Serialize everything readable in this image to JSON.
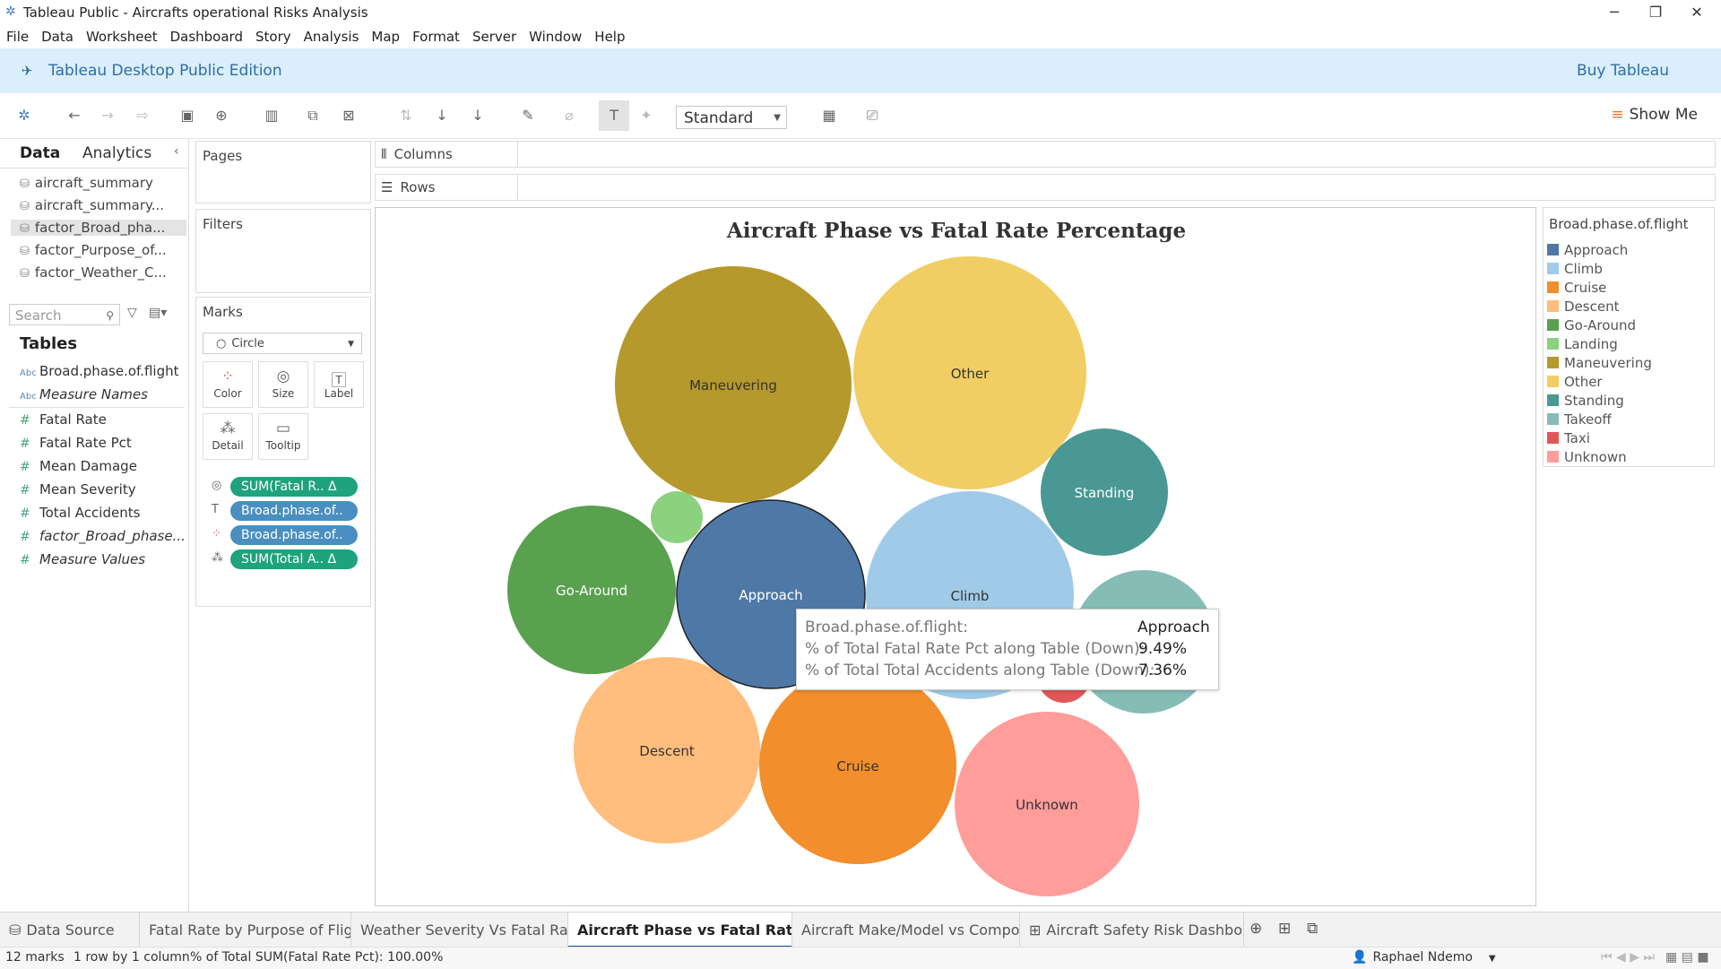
{
  "window": {
    "title": "Tableau Public - Aircrafts operational Risks Analysis"
  },
  "menu": [
    "File",
    "Data",
    "Worksheet",
    "Dashboard",
    "Story",
    "Analysis",
    "Map",
    "Format",
    "Server",
    "Window",
    "Help"
  ],
  "banner": {
    "edition": "Tableau Desktop Public Edition",
    "buy": "Buy Tableau"
  },
  "toolbar": {
    "fit_mode": "Standard",
    "show_me": "Show Me"
  },
  "data_pane": {
    "tab_data": "Data",
    "tab_analytics": "Analytics",
    "sources": [
      "aircraft_summary",
      "aircraft_summary...",
      "factor_Broad_pha...",
      "factor_Purpose_of...",
      "factor_Weather_C..."
    ],
    "search_placeholder": "Search",
    "tables_heading": "Tables",
    "fields": [
      {
        "label": "Broad.phase.of.flight",
        "type": "Abc"
      },
      {
        "label": "Measure Names",
        "type": "Abc"
      },
      {
        "label": "Fatal Rate",
        "type": "#"
      },
      {
        "label": "Fatal Rate Pct",
        "type": "#"
      },
      {
        "label": "Mean Damage",
        "type": "#"
      },
      {
        "label": "Mean Severity",
        "type": "#"
      },
      {
        "label": "Total Accidents",
        "type": "#"
      },
      {
        "label": "factor_Broad_phase...",
        "type": "#"
      },
      {
        "label": "Measure Values",
        "type": "#"
      }
    ]
  },
  "cards": {
    "pages": "Pages",
    "filters": "Filters",
    "marks": "Marks",
    "mark_type": "Circle",
    "buttons": [
      "Color",
      "Size",
      "Label",
      "Detail",
      "Tooltip"
    ],
    "pills": [
      "SUM(Fatal R.. Δ",
      "Broad.phase.of..",
      "Broad.phase.of..",
      "SUM(Total A.. Δ"
    ]
  },
  "shelves": {
    "columns": "Columns",
    "rows": "Rows"
  },
  "chart_data": {
    "type": "bubble",
    "title": "Aircraft Phase vs Fatal Rate Percentage",
    "legend_title": "Broad.phase.of.flight",
    "legend_position": "right",
    "categories": [
      "Approach",
      "Climb",
      "Cruise",
      "Descent",
      "Go-Around",
      "Landing",
      "Maneuvering",
      "Other",
      "Standing",
      "Takeoff",
      "Taxi",
      "Unknown"
    ],
    "colors": [
      "#4e79a7",
      "#a0cbe8",
      "#f28e2b",
      "#ffbe7d",
      "#59a14f",
      "#8cd17d",
      "#b6992d",
      "#f1ce63",
      "#499894",
      "#86bcb6",
      "#e15759",
      "#ff9d9a"
    ],
    "bubbles": [
      {
        "label": "Maneuvering",
        "shown": true
      },
      {
        "label": "Other",
        "shown": true
      },
      {
        "label": "Standing",
        "shown": true
      },
      {
        "label": "Landing",
        "shown": false
      },
      {
        "label": "Go-Around",
        "shown": true
      },
      {
        "label": "Climb",
        "shown": true
      },
      {
        "label": "Takeoff",
        "shown": false
      },
      {
        "label": "Taxi",
        "shown": true
      },
      {
        "label": "Descent",
        "shown": true
      },
      {
        "label": "Cruise",
        "shown": true
      },
      {
        "label": "Unknown",
        "shown": true
      },
      {
        "label": "Approach",
        "shown": true
      }
    ]
  },
  "tooltip": {
    "rows": [
      {
        "label": "Broad.phase.of.flight:",
        "value": "Approach"
      },
      {
        "label": "% of Total Fatal Rate Pct along Table (Down):",
        "value": "9.49%"
      },
      {
        "label": "% of Total Total Accidents along Table (Down):",
        "value": "7.36%"
      }
    ]
  },
  "sheet_tabs": [
    {
      "label": "Data Source",
      "active": false
    },
    {
      "label": "Fatal Rate by Purpose of Flight",
      "active": false
    },
    {
      "label": "Weather Severity Vs Fatal Rate",
      "active": false
    },
    {
      "label": "Aircraft Phase vs Fatal Rate Pe...",
      "active": true
    },
    {
      "label": "Aircraft Make/Model vs Compos...",
      "active": false
    },
    {
      "label": "Aircraft Safety Risk Dashboar...",
      "active": false
    }
  ],
  "status": {
    "marks": "12 marks",
    "rows": "1 row by 1 column",
    "sum": "% of Total SUM(Fatal Rate Pct): 100.00%",
    "user": "Raphael Ndemo"
  }
}
